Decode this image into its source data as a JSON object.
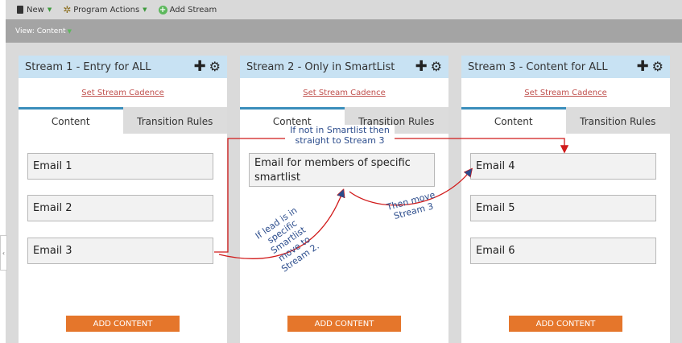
{
  "toolbar": {
    "new_label": "New",
    "program_actions_label": "Program Actions",
    "add_stream_label": "Add Stream"
  },
  "viewbar": {
    "label": "View: Content"
  },
  "streams": [
    {
      "title": "Stream 1 - Entry for ALL",
      "cadence": "Set Stream Cadence",
      "tab_content": "Content",
      "tab_transition": "Transition Rules",
      "emails": [
        "Email 1",
        "Email 2",
        "Email 3"
      ],
      "add_button": "ADD CONTENT"
    },
    {
      "title": "Stream 2 - Only in SmartList",
      "cadence": "Set Stream Cadence",
      "tab_content": "Content",
      "tab_transition": "Transition Rules",
      "emails": [
        "Email for members of specific smartlist"
      ],
      "add_button": "ADD CONTENT"
    },
    {
      "title": "Stream 3 - Content for ALL",
      "cadence": "Set Stream Cadence",
      "tab_content": "Content",
      "tab_transition": "Transition Rules",
      "emails": [
        "Email 4",
        "Email 5",
        "Email 6"
      ],
      "add_button": "ADD CONTENT"
    }
  ],
  "annotations": {
    "top": "If not in Smartlist then straight to Stream 3",
    "lead": "If lead is in specific Smartlist move to Stream 2.",
    "then": "Then move Stream 3"
  },
  "colors": {
    "stream_header": "#c8e2f3",
    "active_tab_border": "#3a8ebb",
    "cadence_link": "#c0504d",
    "add_button": "#e5762b",
    "arrow": "#d11a1a",
    "annotation_text": "#2b4c8c"
  }
}
